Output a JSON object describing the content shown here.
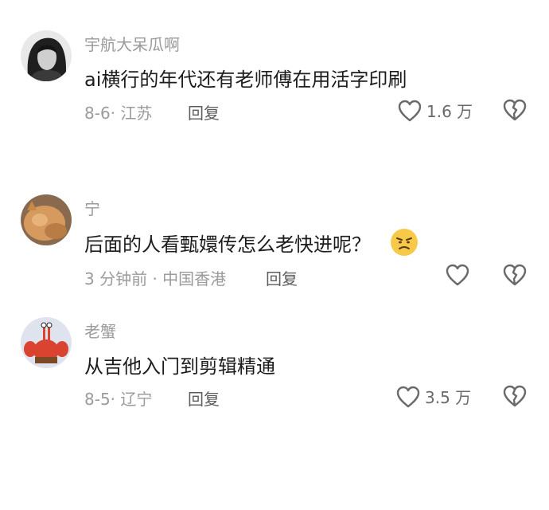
{
  "comments": [
    {
      "username": "宇航大呆瓜啊",
      "text": "ai横行的年代还有老师傅在用活字印刷",
      "meta": "8-6· 江苏",
      "reply_label": "回复",
      "like_count": "1.6 万",
      "avatar_desc": "woman-portrait-bw"
    },
    {
      "username": "宁",
      "text": "后面的人看甄嬛传怎么老快进呢？",
      "emoji": "annoyed-face-emoji",
      "meta": "3 分钟前 · 中国香港",
      "reply_label": "回复",
      "like_count": "",
      "avatar_desc": "cat-orange"
    },
    {
      "username": "老蟹",
      "text": "从吉他入门到剪辑精通",
      "meta": "8-5· 辽宁",
      "reply_label": "回复",
      "like_count": "3.5 万",
      "avatar_desc": "mr-krabs-cartoon"
    }
  ],
  "icons": {
    "like": "heart-outline-icon",
    "dislike": "broken-heart-icon"
  },
  "colors": {
    "text": "#1c1c1c",
    "secondary": "#9b9b9b",
    "icon": "#6a6a6a"
  }
}
